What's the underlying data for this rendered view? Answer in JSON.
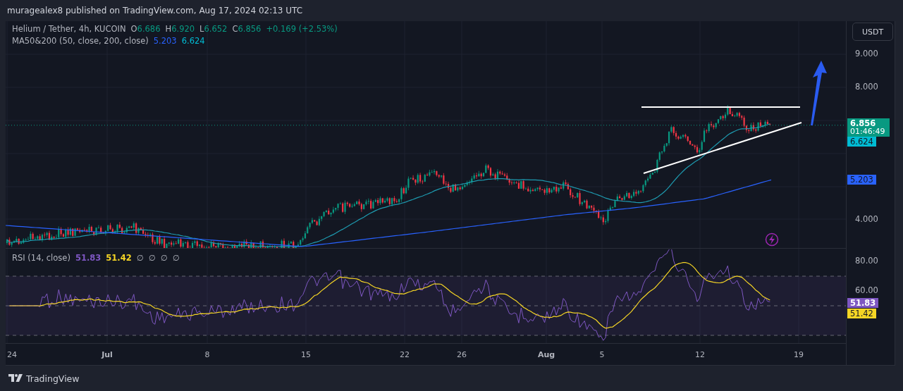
{
  "header": {
    "text": "muragealex8 published on TradingView.com, Aug 17, 2024 02:13 UTC"
  },
  "legend": {
    "symbol": "Helium / Tether, 4h, KUCOIN",
    "ohlc": [
      {
        "key": "O",
        "value": "6.686"
      },
      {
        "key": "H",
        "value": "6.920"
      },
      {
        "key": "L",
        "value": "6.652"
      },
      {
        "key": "C",
        "value": "6.856"
      }
    ],
    "change": "+0.169 (+2.53%)"
  },
  "ma_legend": {
    "name": "MA50&200 (50, close, 200, close)",
    "values": [
      {
        "text": "5.203",
        "color": "#2962ff"
      },
      {
        "text": "6.624",
        "color": "#00bcd4"
      }
    ]
  },
  "currency_button": "USDT",
  "price_axis": {
    "ticks": [
      "9.000",
      "8.000",
      "4.000"
    ]
  },
  "price_labels": [
    {
      "kind": "last",
      "value": "6.856",
      "countdown": "01:46:49",
      "color": "#089981"
    },
    {
      "kind": "ma",
      "value": "6.624",
      "color": "#00bcd4"
    },
    {
      "kind": "ma",
      "value": "5.203",
      "color": "#2962ff"
    }
  ],
  "rsi_legend": {
    "name": "RSI (14, close)",
    "values": [
      {
        "text": "51.83",
        "color": "#7e57c2"
      },
      {
        "text": "51.42",
        "color": "#f5d525"
      }
    ],
    "extras": [
      "∅",
      "∅",
      "∅",
      "∅"
    ]
  },
  "rsi_axis": {
    "ticks": [
      "80.00",
      "60.00"
    ]
  },
  "rsi_labels": [
    {
      "value": "51.83",
      "color": "#7e57c2"
    },
    {
      "value": "51.42",
      "color": "#f5d525"
    }
  ],
  "time_axis": {
    "ticks": [
      {
        "label": "24",
        "bold": false
      },
      {
        "label": "Jul",
        "bold": true
      },
      {
        "label": "8",
        "bold": false
      },
      {
        "label": "15",
        "bold": false
      },
      {
        "label": "22",
        "bold": false
      },
      {
        "label": "26",
        "bold": false
      },
      {
        "label": "Aug",
        "bold": true
      },
      {
        "label": "5",
        "bold": false
      },
      {
        "label": "12",
        "bold": false
      },
      {
        "label": "19",
        "bold": false
      }
    ]
  },
  "footer": {
    "brand": "TradingView"
  }
}
